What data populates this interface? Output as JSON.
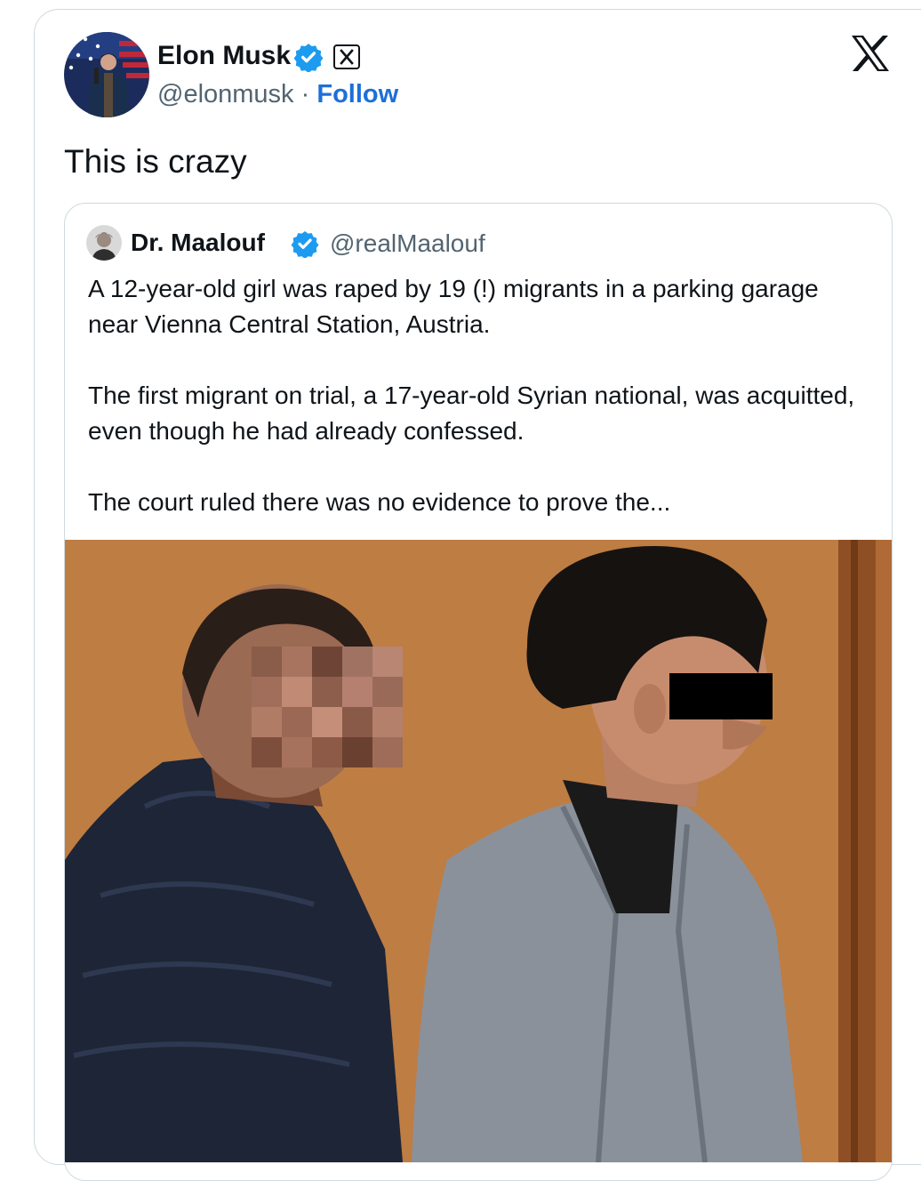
{
  "tweet": {
    "author_name": "Elon Musk",
    "author_handle": "@elonmusk",
    "separator": "·",
    "follow_label": "Follow",
    "text": "This is crazy",
    "verified_icon": "verified-badge-icon",
    "affiliate_icon": "x-affiliate-badge-icon",
    "brand_icon": "x-logo-icon"
  },
  "quote": {
    "author_name": "Dr. Maalouf",
    "author_handle": "@realMaalouf",
    "paragraphs": [
      "A 12-year-old girl was raped by 19 (!) migrants in a parking garage near Vienna Central Station, Austria.",
      "The first migrant on trial, a 17-year-old Syrian national, was acquitted, even though he had already confessed.",
      "The court ruled there was no evidence to prove the..."
    ]
  },
  "colors": {
    "follow": "#1d6fd8",
    "verified": "#1d9bf0",
    "secondary_text": "#536471",
    "border": "#cfd9de",
    "wall": "#b9773f"
  }
}
